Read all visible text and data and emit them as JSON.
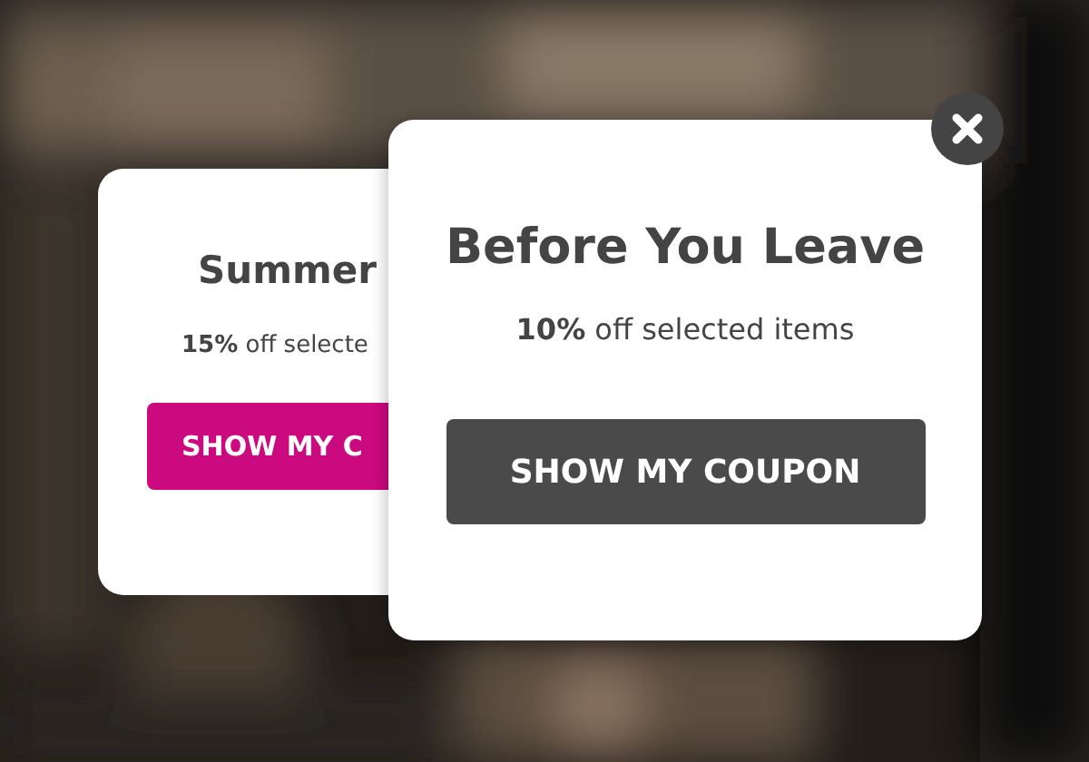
{
  "popups": [
    {
      "title": "Summer",
      "offer": "**15%** off selecte",
      "button": "SHOW MY C",
      "color": "#cc0a80",
      "kind": "back"
    },
    {
      "title": "Before You Leave",
      "offer": "**10%** off selected items",
      "button": "SHOW MY COUPON",
      "color": "#4a4a4a",
      "kind": "front"
    }
  ]
}
